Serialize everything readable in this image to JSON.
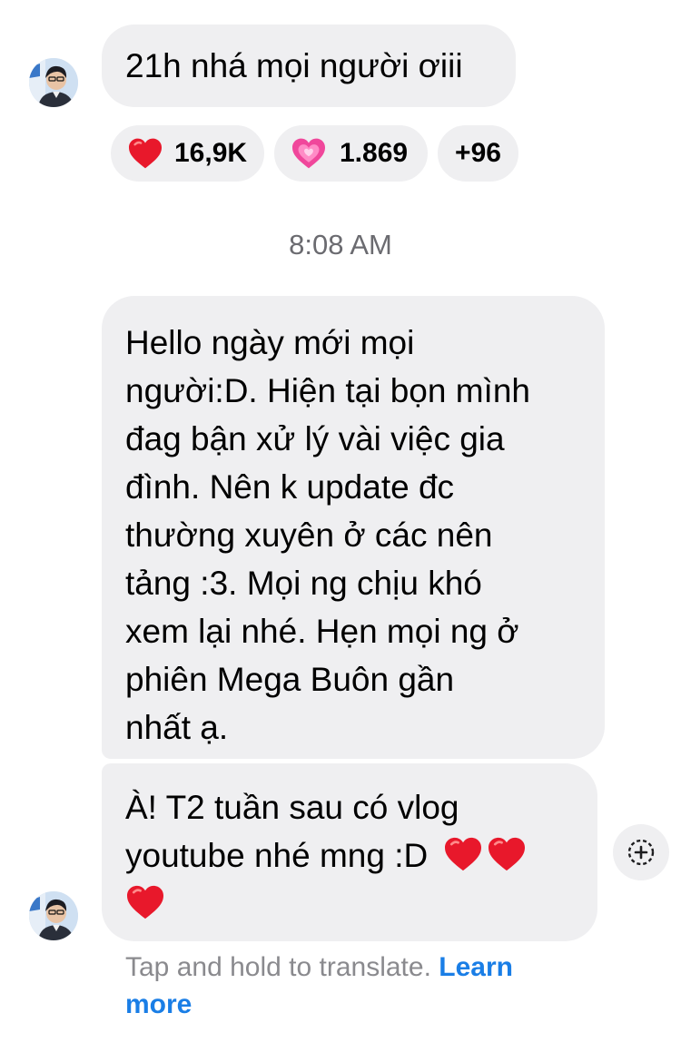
{
  "messages": {
    "first": {
      "text": "21h nhá mọi người ơiii"
    },
    "reactions": [
      {
        "icon": "red-heart",
        "count": "16,9K"
      },
      {
        "icon": "pink-heart",
        "count": "1.869"
      },
      {
        "icon": "more",
        "count": "+96"
      }
    ],
    "timestamp": "8:08 AM",
    "second": {
      "lines": [
        "Hello ngày mới mọi",
        "người:D. Hiện tại bọn mình",
        "đag bận xử lý vài việc gia",
        "đình. Nên k update đc",
        "thường xuyên ở các nên",
        "tảng :3. Mọi ng chịu khó",
        "xem lại nhé. Hẹn mọi ng ở",
        "phiên Mega Buôn gần",
        "nhất ạ."
      ]
    },
    "third": {
      "line1": "À! T2 tuần sau có vlog",
      "line2": "youtube nhé mng :D",
      "hearts": [
        "red-heart",
        "red-heart",
        "red-heart"
      ]
    }
  },
  "translate": {
    "hint": "Tap and hold to translate.",
    "link_word1": "Learn",
    "link_word2": "more"
  },
  "icons": {
    "add_reaction": "add-reaction-icon",
    "avatar": "profile-avatar"
  },
  "colors": {
    "bubble": "#efeff1",
    "link": "#1a7ee6",
    "heart_red": "#e8182b",
    "heart_pink": "#f0479b"
  }
}
